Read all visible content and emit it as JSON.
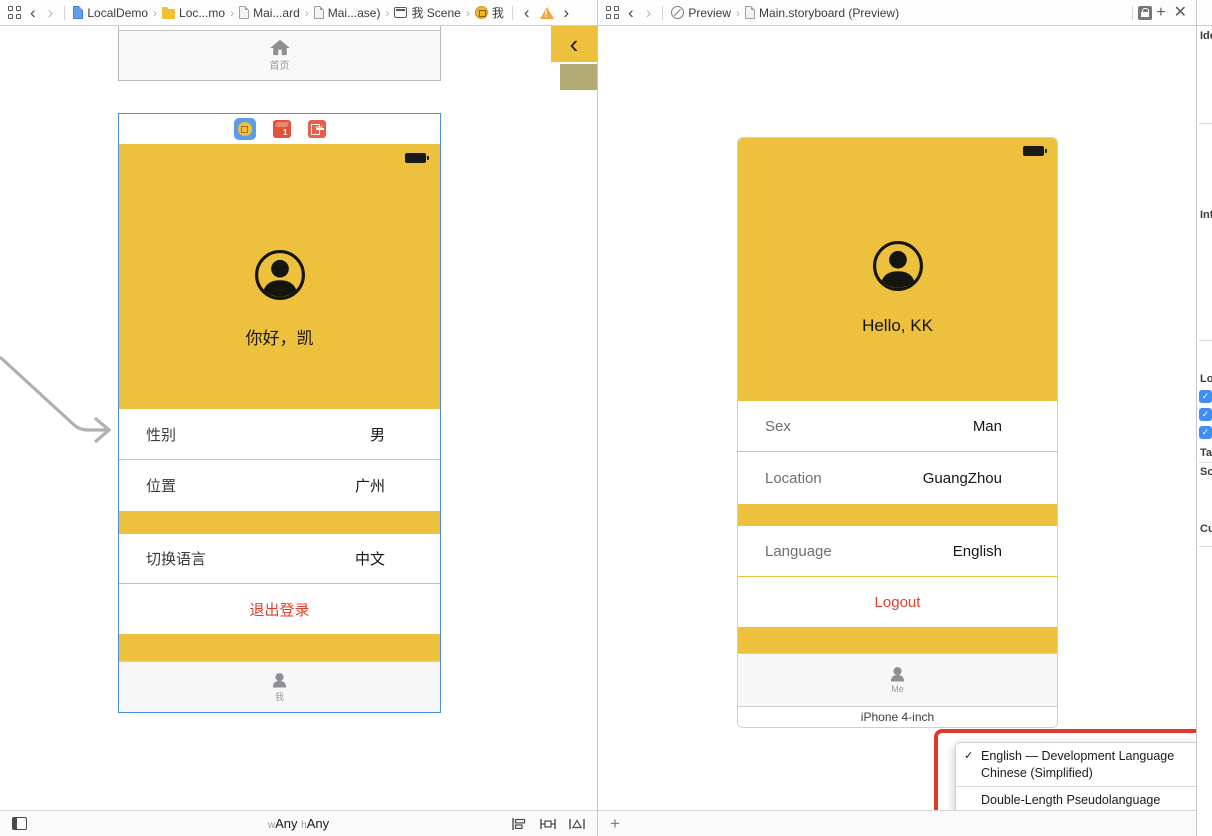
{
  "toolbar_left": {
    "crumbs": [
      "LocalDemo",
      "Loc...mo",
      "Mai...ard",
      "Mai...ase)",
      "我 Scene",
      "我"
    ]
  },
  "toolbar_right": {
    "preview_label": "Preview",
    "file_label": "Main.storyboard (Preview)"
  },
  "icons": {
    "back_chevron": "‹",
    "forward_chevron": "›",
    "crumb_sep": "›",
    "nav_back_big": "‹",
    "check": "✓",
    "plus": "+",
    "close": "✕",
    "warning_mark": "!",
    "first_responder_number": "1"
  },
  "canvas": {
    "home_tab_label": "首页",
    "scene": {
      "greeting": "你好，凯",
      "sex_label": "性别",
      "sex_value": "男",
      "location_label": "位置",
      "location_value": "广州",
      "language_label": "切换语言",
      "language_value": "中文",
      "logout_label": "退出登录",
      "tab_label": "我"
    }
  },
  "preview": {
    "greeting": "Hello, KK",
    "sex_label": "Sex",
    "sex_value": "Man",
    "location_label": "Location",
    "location_value": "GuangZhou",
    "language_label": "Language",
    "language_value": "English",
    "logout_label": "Logout",
    "tab_label": "Me",
    "device_label": "iPhone 4-inch"
  },
  "language_menu": {
    "items": [
      {
        "label": "English — Development Language",
        "checked": true
      },
      {
        "label": "Chinese (Simplified)",
        "checked": false
      },
      {
        "label": "Double-Length Pseudolanguage",
        "checked": false
      }
    ],
    "current": "English"
  },
  "size_class": {
    "w_key": "w",
    "w_value": "Any",
    "h_key": "h",
    "h_value": "Any"
  },
  "inspector": {
    "fragments": [
      "Ide",
      "Int",
      "Lo",
      "Ta",
      "Sc",
      "Cu"
    ]
  },
  "colors": {
    "app_yellow": "#EDC13E",
    "accent_red": "#E2402F",
    "selection_blue": "#4A90E2",
    "annotation_red": "#E0382C"
  }
}
